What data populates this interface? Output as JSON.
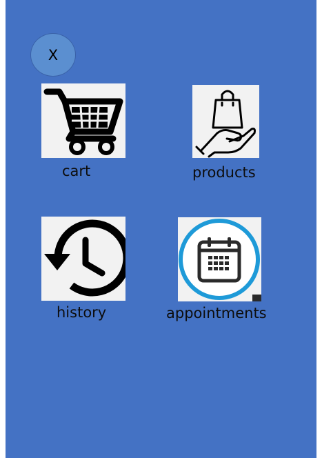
{
  "menu": {
    "close_label": "X",
    "items": [
      {
        "label": "cart",
        "icon": "shopping-cart-icon"
      },
      {
        "label": "products",
        "icon": "hand-shopping-bag-icon"
      },
      {
        "label": "history",
        "icon": "clock-history-icon"
      },
      {
        "label": "appointments",
        "icon": "calendar-icon"
      }
    ]
  },
  "colors": {
    "background": "#4472c4",
    "close_button": "#5b8fd0",
    "calendar_ring": "#1e9ad8"
  }
}
